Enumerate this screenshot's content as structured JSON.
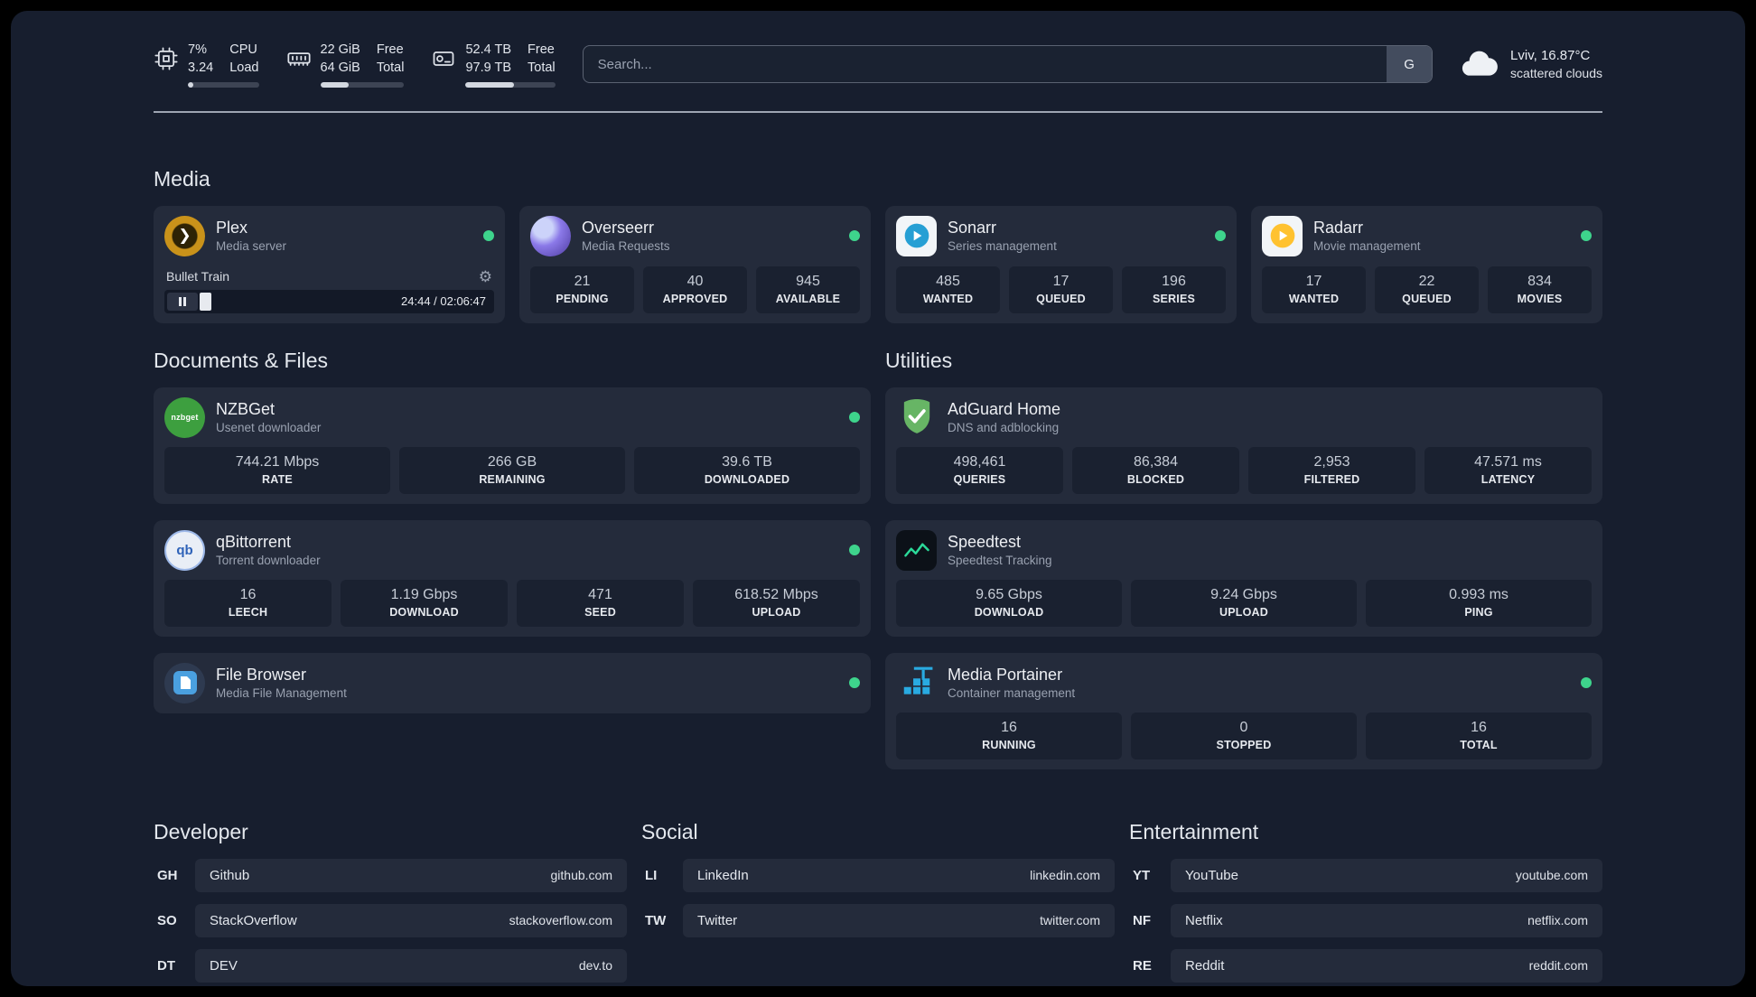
{
  "header": {
    "cpu": {
      "value1": "7%",
      "value2": "3.24",
      "label1": "CPU",
      "label2": "Load",
      "bar_percent": 8
    },
    "ram": {
      "value1": "22 GiB",
      "value2": "64 GiB",
      "label1": "Free",
      "label2": "Total",
      "bar_percent": 34
    },
    "disk": {
      "value1": "52.4 TB",
      "value2": "97.9 TB",
      "label1": "Free",
      "label2": "Total",
      "bar_percent": 54
    },
    "search": {
      "placeholder": "Search...",
      "provider": "G"
    },
    "weather": {
      "location": "Lviv, 16.87°C",
      "condition": "scattered clouds"
    }
  },
  "groups": {
    "media": {
      "title": "Media",
      "plex": {
        "name": "Plex",
        "subtitle": "Media server",
        "status": "online",
        "player": {
          "track": "Bullet Train",
          "time": "24:44 / 02:06:47",
          "progress_percent": 6
        }
      },
      "overseerr": {
        "name": "Overseerr",
        "subtitle": "Media Requests",
        "status": "online",
        "stats": [
          {
            "value": "21",
            "label": "PENDING"
          },
          {
            "value": "40",
            "label": "APPROVED"
          },
          {
            "value": "945",
            "label": "AVAILABLE"
          }
        ]
      },
      "sonarr": {
        "name": "Sonarr",
        "subtitle": "Series management",
        "status": "online",
        "stats": [
          {
            "value": "485",
            "label": "WANTED"
          },
          {
            "value": "17",
            "label": "QUEUED"
          },
          {
            "value": "196",
            "label": "SERIES"
          }
        ]
      },
      "radarr": {
        "name": "Radarr",
        "subtitle": "Movie management",
        "status": "online",
        "stats": [
          {
            "value": "17",
            "label": "WANTED"
          },
          {
            "value": "22",
            "label": "QUEUED"
          },
          {
            "value": "834",
            "label": "MOVIES"
          }
        ]
      }
    },
    "documents": {
      "title": "Documents & Files",
      "nzbget": {
        "name": "NZBGet",
        "subtitle": "Usenet downloader",
        "status": "online",
        "stats": [
          {
            "value": "744.21 Mbps",
            "label": "RATE"
          },
          {
            "value": "266 GB",
            "label": "REMAINING"
          },
          {
            "value": "39.6 TB",
            "label": "DOWNLOADED"
          }
        ]
      },
      "qbittorrent": {
        "name": "qBittorrent",
        "subtitle": "Torrent downloader",
        "status": "online",
        "stats": [
          {
            "value": "16",
            "label": "LEECH"
          },
          {
            "value": "1.19 Gbps",
            "label": "DOWNLOAD"
          },
          {
            "value": "471",
            "label": "SEED"
          },
          {
            "value": "618.52 Mbps",
            "label": "UPLOAD"
          }
        ]
      },
      "filebrowser": {
        "name": "File Browser",
        "subtitle": "Media File Management",
        "status": "online"
      }
    },
    "utilities": {
      "title": "Utilities",
      "adguard": {
        "name": "AdGuard Home",
        "subtitle": "DNS and adblocking",
        "stats": [
          {
            "value": "498,461",
            "label": "QUERIES"
          },
          {
            "value": "86,384",
            "label": "BLOCKED"
          },
          {
            "value": "2,953",
            "label": "FILTERED"
          },
          {
            "value": "47.571 ms",
            "label": "LATENCY"
          }
        ]
      },
      "speedtest": {
        "name": "Speedtest",
        "subtitle": "Speedtest Tracking",
        "stats": [
          {
            "value": "9.65 Gbps",
            "label": "DOWNLOAD"
          },
          {
            "value": "9.24 Gbps",
            "label": "UPLOAD"
          },
          {
            "value": "0.993 ms",
            "label": "PING"
          }
        ]
      },
      "portainer": {
        "name": "Media Portainer",
        "subtitle": "Container management",
        "status": "online",
        "stats": [
          {
            "value": "16",
            "label": "RUNNING"
          },
          {
            "value": "0",
            "label": "STOPPED"
          },
          {
            "value": "16",
            "label": "TOTAL"
          }
        ]
      }
    }
  },
  "bookmarks": {
    "developer": {
      "title": "Developer",
      "items": [
        {
          "abbr": "GH",
          "name": "Github",
          "domain": "github.com"
        },
        {
          "abbr": "SO",
          "name": "StackOverflow",
          "domain": "stackoverflow.com"
        },
        {
          "abbr": "DT",
          "name": "DEV",
          "domain": "dev.to"
        }
      ]
    },
    "social": {
      "title": "Social",
      "items": [
        {
          "abbr": "LI",
          "name": "LinkedIn",
          "domain": "linkedin.com"
        },
        {
          "abbr": "TW",
          "name": "Twitter",
          "domain": "twitter.com"
        }
      ]
    },
    "entertainment": {
      "title": "Entertainment",
      "items": [
        {
          "abbr": "YT",
          "name": "YouTube",
          "domain": "youtube.com"
        },
        {
          "abbr": "NF",
          "name": "Netflix",
          "domain": "netflix.com"
        },
        {
          "abbr": "RE",
          "name": "Reddit",
          "domain": "reddit.com"
        }
      ]
    }
  },
  "icons": {
    "cpu": "cpu-chip",
    "ram": "memory-stick",
    "disk": "hard-drive",
    "weather": "cloud",
    "plex_chevron": "❯",
    "gear": "⚙",
    "pause": "pause-bars",
    "nzbget_text": "nzbget",
    "qbittorrent_text": "qb"
  },
  "colors": {
    "status_online": "#3ed48c"
  }
}
